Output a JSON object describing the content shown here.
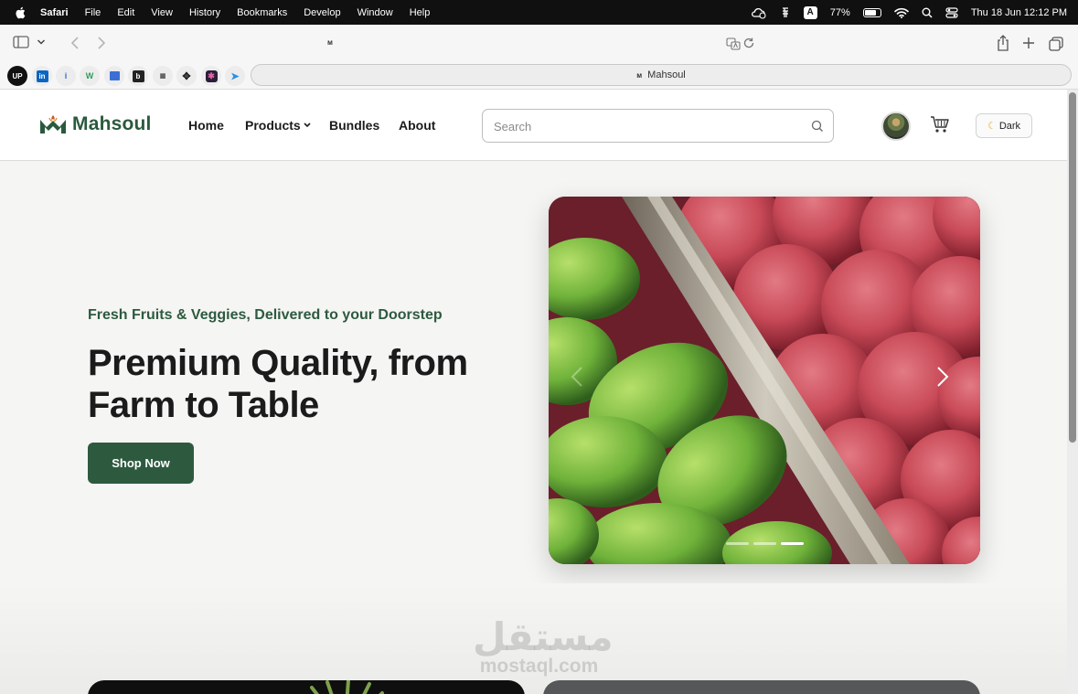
{
  "menubar": {
    "app": "Safari",
    "items": [
      "File",
      "Edit",
      "View",
      "History",
      "Bookmarks",
      "Develop",
      "Window",
      "Help"
    ],
    "battery": "77%",
    "battery_level": 0.77,
    "input_source": "A",
    "datetime": "Thu 18 Jun  12:12 PM"
  },
  "browser": {
    "tab_title": "Mahsoul",
    "favorites": [
      "upwork",
      "linkedin",
      "info",
      "w",
      "flag",
      "b",
      "grid",
      "arrows",
      "figma",
      "send"
    ]
  },
  "site": {
    "brand": "Mahsoul",
    "brand_color": "#2d5a3f",
    "nav": {
      "home": "Home",
      "products": "Products",
      "bundles": "Bundles",
      "about": "About"
    },
    "search": {
      "placeholder": "Search"
    },
    "theme_toggle": "Dark",
    "hero": {
      "subtitle": "Fresh Fruits & Veggies, Delivered to your Doorstep",
      "title": "Premium Quality, from Farm to Table",
      "cta": "Shop Now"
    },
    "carousel": {
      "slide_count": 3,
      "active_slide": 3
    },
    "watermark": {
      "arabic": "مستقل",
      "latin": "mostaql.com"
    }
  }
}
